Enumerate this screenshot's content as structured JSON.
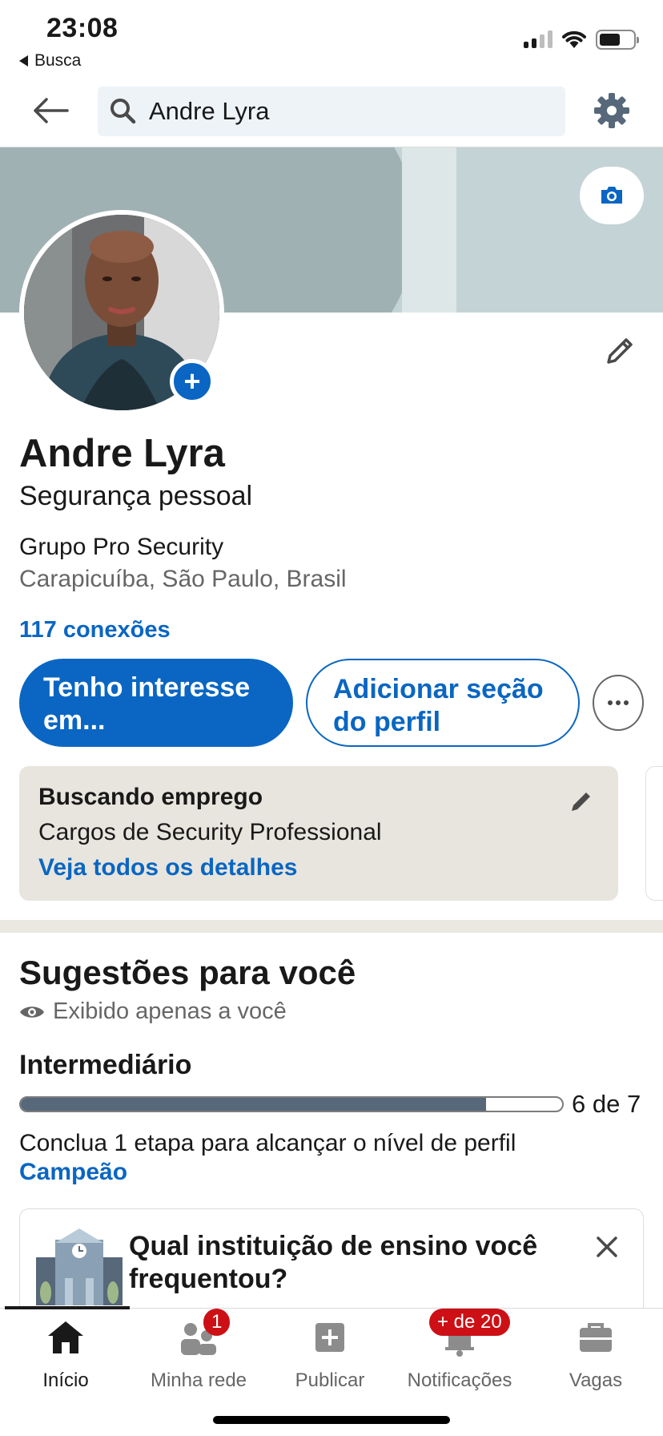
{
  "status_bar": {
    "time": "23:08",
    "back_app": "Busca"
  },
  "search": {
    "value": "Andre Lyra"
  },
  "profile": {
    "name": "Andre Lyra",
    "headline": "Segurança pessoal",
    "company": "Grupo Pro Security",
    "location": "Carapicuíba, São Paulo, Brasil",
    "connections": "117 conexões"
  },
  "actions": {
    "primary_label": "Tenho interesse em...",
    "secondary_label": "Adicionar seção do perfil"
  },
  "open_to_work": {
    "title": "Buscando emprego",
    "roles": "Cargos de Security Professional",
    "link": "Veja todos os detalhes"
  },
  "suggestions": {
    "title": "Sugestões para você",
    "visibility": "Exibido apenas a você",
    "level": "Intermediário",
    "progress_text": "6 de 7",
    "progress_fraction": 0.86,
    "help": "Conclua 1 etapa para alcançar o nível de perfil",
    "target_level": "Campeão",
    "card_question": "Qual instituição de ensino você frequentou?"
  },
  "bottom_nav": {
    "items": [
      {
        "label": "Início",
        "icon": "home-icon"
      },
      {
        "label": "Minha rede",
        "icon": "network-icon",
        "badge": "1"
      },
      {
        "label": "Publicar",
        "icon": "post-icon"
      },
      {
        "label": "Notificações",
        "icon": "bell-icon",
        "badge": "+ de 20"
      },
      {
        "label": "Vagas",
        "icon": "briefcase-icon"
      }
    ]
  },
  "colors": {
    "brand": "#0a66c2",
    "badge": "#cc1016",
    "card_bg": "#e8e5de",
    "progress": "#56687a"
  }
}
